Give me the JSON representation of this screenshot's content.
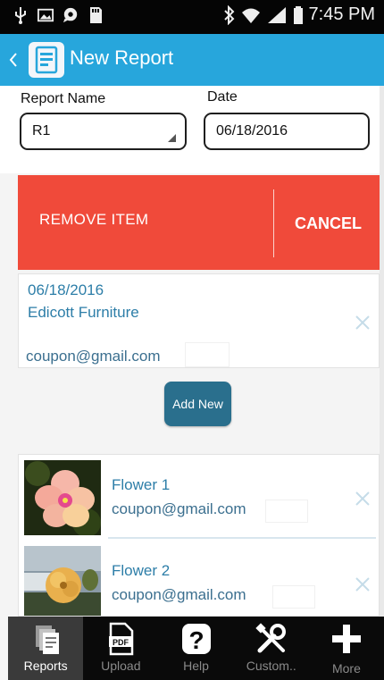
{
  "status_bar": {
    "time": "7:45 PM"
  },
  "header": {
    "title": "New Report"
  },
  "form": {
    "report_name_label": "Report Name",
    "report_name_value": "R1",
    "date_label": "Date",
    "date_value": "06/18/2016"
  },
  "action_bar": {
    "remove_label": "REMOVE ITEM",
    "cancel_label": "CANCEL"
  },
  "report_card": {
    "date": "06/18/2016",
    "company": "Edicott Furniture",
    "email": "coupon@gmail.com"
  },
  "add_new_label": "Add New",
  "items": [
    {
      "title": "Flower 1",
      "email": "coupon@gmail.com"
    },
    {
      "title": "Flower 2",
      "email": "coupon@gmail.com"
    }
  ],
  "bottom_nav": [
    {
      "label": "Reports",
      "icon": "reports-icon"
    },
    {
      "label": "Upload",
      "icon": "pdf-icon"
    },
    {
      "label": "Help",
      "icon": "help-icon"
    },
    {
      "label": "Custom..",
      "icon": "tools-icon"
    },
    {
      "label": "More",
      "icon": "plus-icon"
    }
  ],
  "colors": {
    "accent": "#27a6dc",
    "action_bar": "#f04a3a",
    "button": "#2a6f8d",
    "link_text": "#2d7ea8"
  }
}
